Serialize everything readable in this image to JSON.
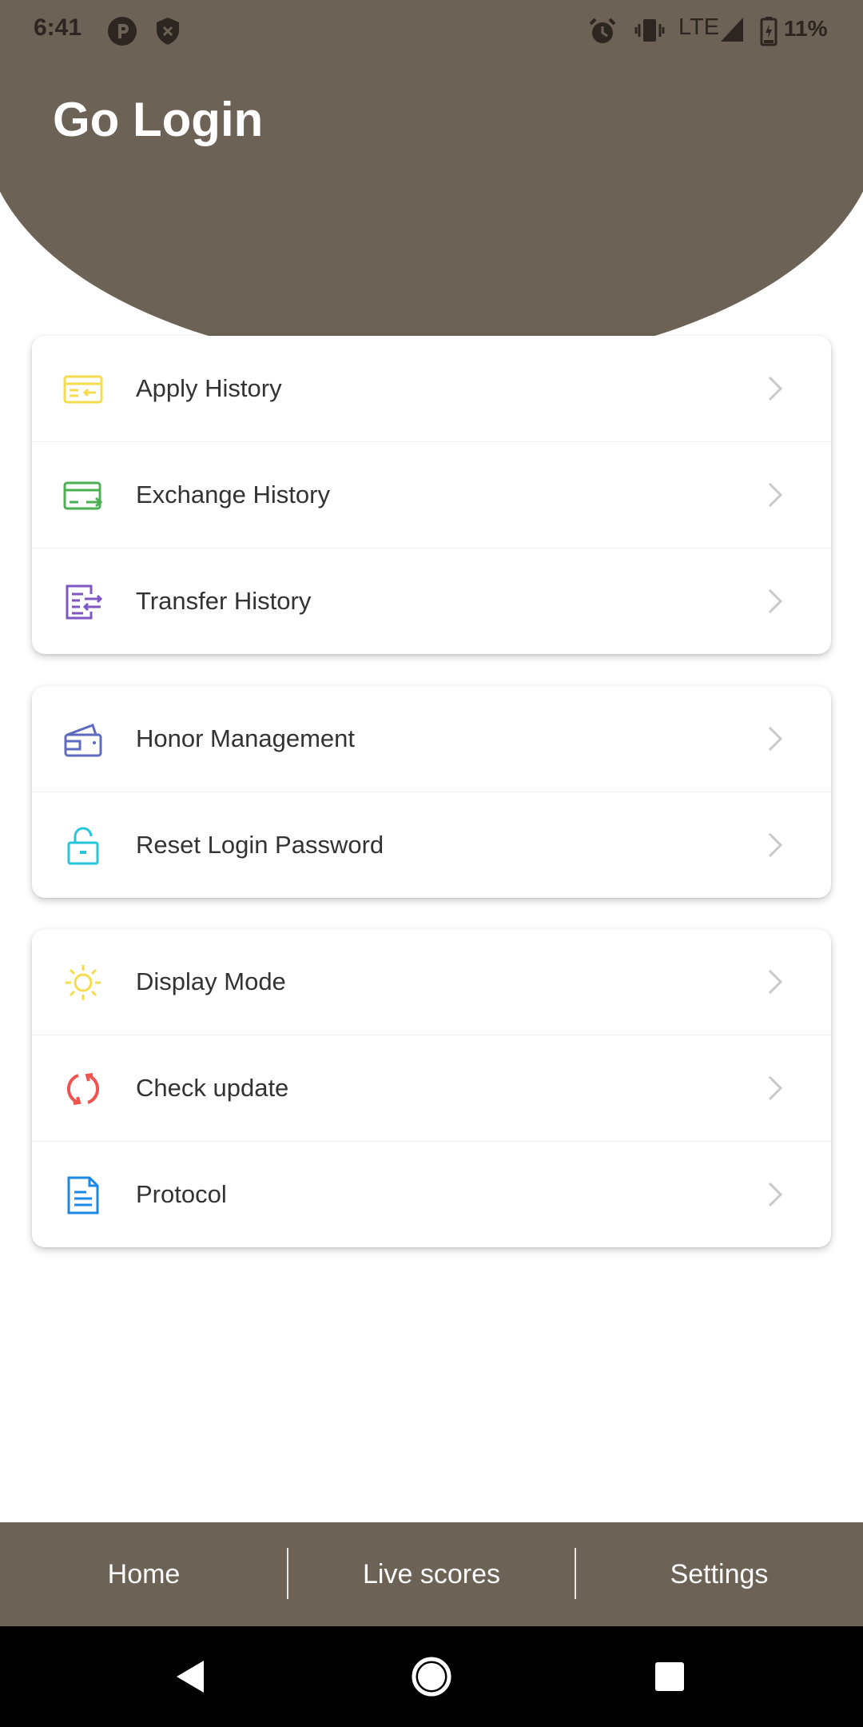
{
  "status_bar": {
    "time": "6:41",
    "network": "LTE",
    "battery": "11%",
    "icons": [
      "app-notification-icon",
      "shield-icon",
      "alarm-icon",
      "vibrate-icon",
      "signal-icon",
      "battery-icon"
    ]
  },
  "header": {
    "title": "Go Login",
    "color": "#6c6255"
  },
  "groups": [
    {
      "items": [
        {
          "label": "Apply History",
          "icon": "apply-history-icon",
          "color": "#f5dc4c"
        },
        {
          "label": "Exchange History",
          "icon": "exchange-history-icon",
          "color": "#4caf50"
        },
        {
          "label": "Transfer History",
          "icon": "transfer-history-icon",
          "color": "#7e57c2"
        }
      ]
    },
    {
      "items": [
        {
          "label": "Honor Management",
          "icon": "wallet-icon",
          "color": "#5c6bc0"
        },
        {
          "label": "Reset Login Password",
          "icon": "lock-icon",
          "color": "#26c6da"
        }
      ]
    },
    {
      "items": [
        {
          "label": "Display Mode",
          "icon": "sun-icon",
          "color": "#f5dc4c"
        },
        {
          "label": "Check update",
          "icon": "refresh-icon",
          "color": "#ef5350"
        },
        {
          "label": "Protocol",
          "icon": "document-icon",
          "color": "#1e88e5"
        }
      ]
    }
  ],
  "bottom_nav": {
    "items": [
      {
        "label": "Home"
      },
      {
        "label": "Live scores"
      },
      {
        "label": "Settings"
      }
    ]
  },
  "system_nav": {
    "buttons": [
      "back-icon",
      "home-icon",
      "recents-icon"
    ]
  }
}
